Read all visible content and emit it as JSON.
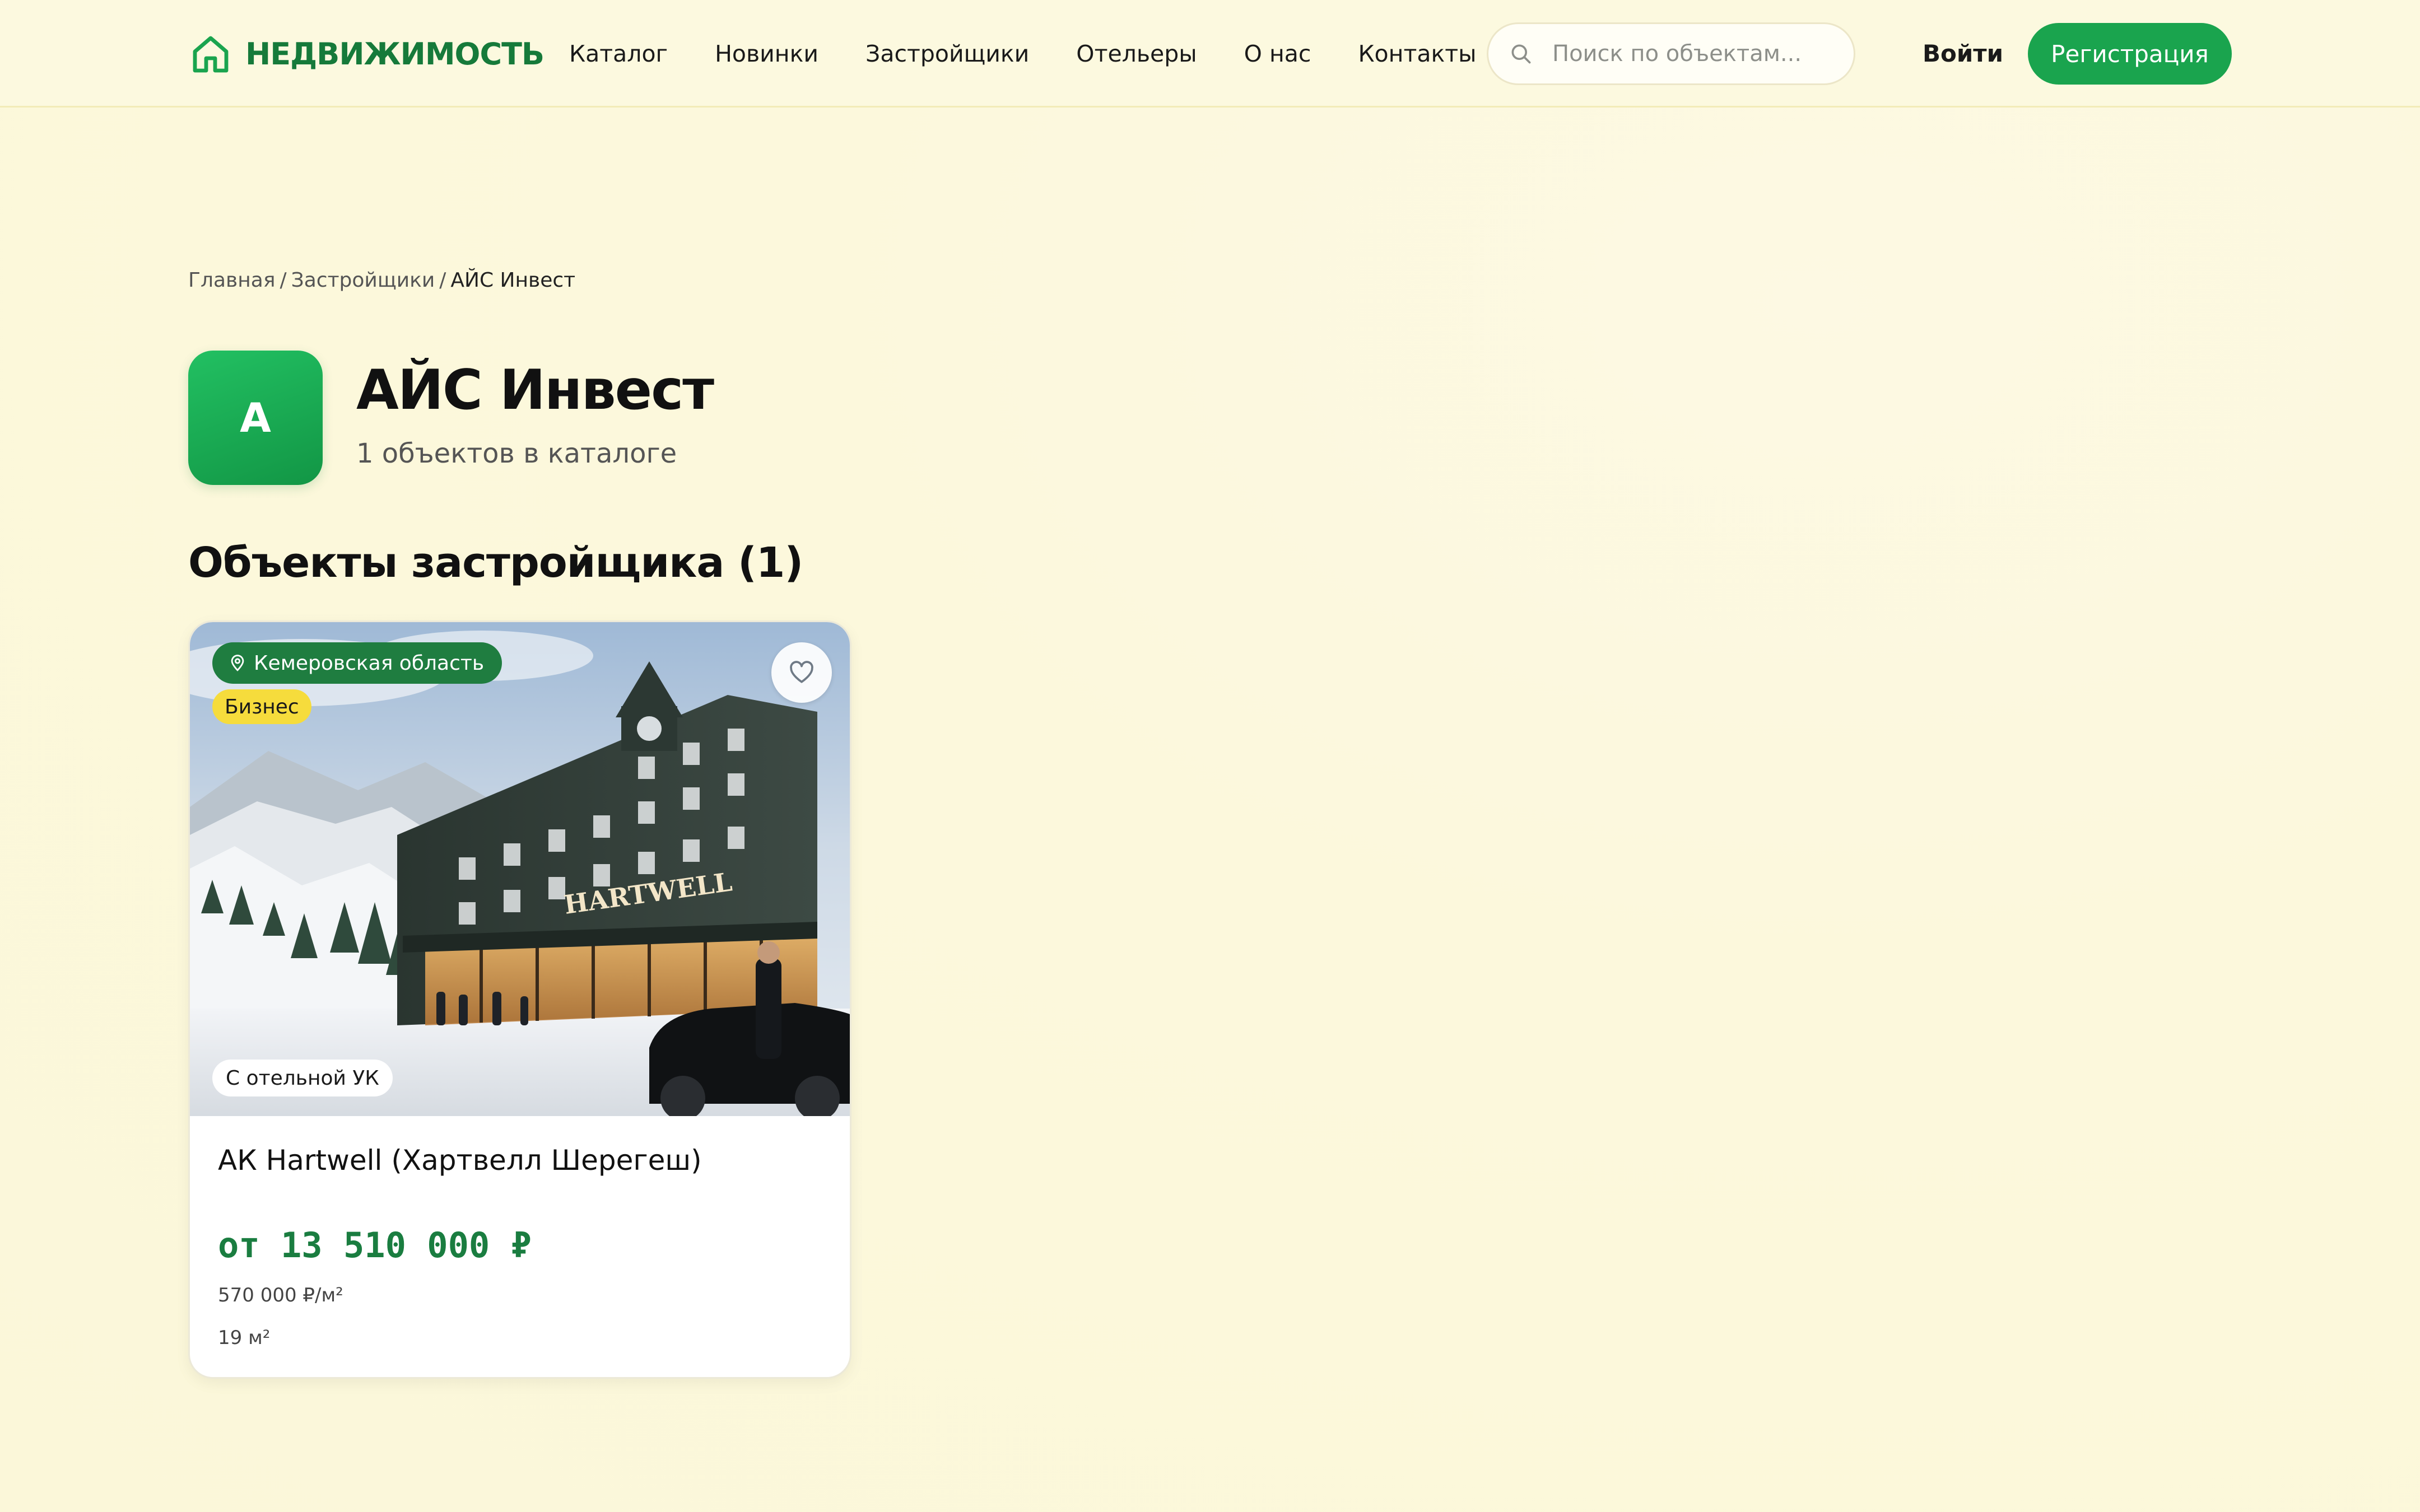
{
  "header": {
    "logo_text": "НЕДВИЖИМОСТЬ",
    "nav": [
      {
        "label": "Каталог"
      },
      {
        "label": "Новинки"
      },
      {
        "label": "Застройщики"
      },
      {
        "label": "Отельеры"
      },
      {
        "label": "О нас"
      },
      {
        "label": "Контакты"
      }
    ],
    "search_placeholder": "Поиск по объектам...",
    "login_label": "Войти",
    "register_label": "Регистрация"
  },
  "breadcrumb": {
    "home": "Главная",
    "developers": "Застройщики",
    "current": "АЙС Инвест",
    "separator": "/"
  },
  "developer": {
    "avatar_letter": "А",
    "name": "АЙС Инвест",
    "objects_count_text": "1 объектов в каталоге"
  },
  "section": {
    "title": "Объекты застройщика (1)"
  },
  "listing": {
    "location": "Кемеровская область",
    "class_label": "Бизнес",
    "hotel_badge": "С отельной УК",
    "image_sign": "HARTWELL",
    "title": "АК Hartwell (Хартвелл Шерегеш)",
    "price": "от 13 510 000 ₽",
    "price_per_m2": "570 000 ₽/м²",
    "area": "19 м²"
  },
  "colors": {
    "brand_green": "#1aa44e",
    "logo_green": "#167a3a",
    "price_green": "#1a7d40",
    "badge_yellow": "#f6dc3c",
    "page_background": "#fcf8dc"
  }
}
